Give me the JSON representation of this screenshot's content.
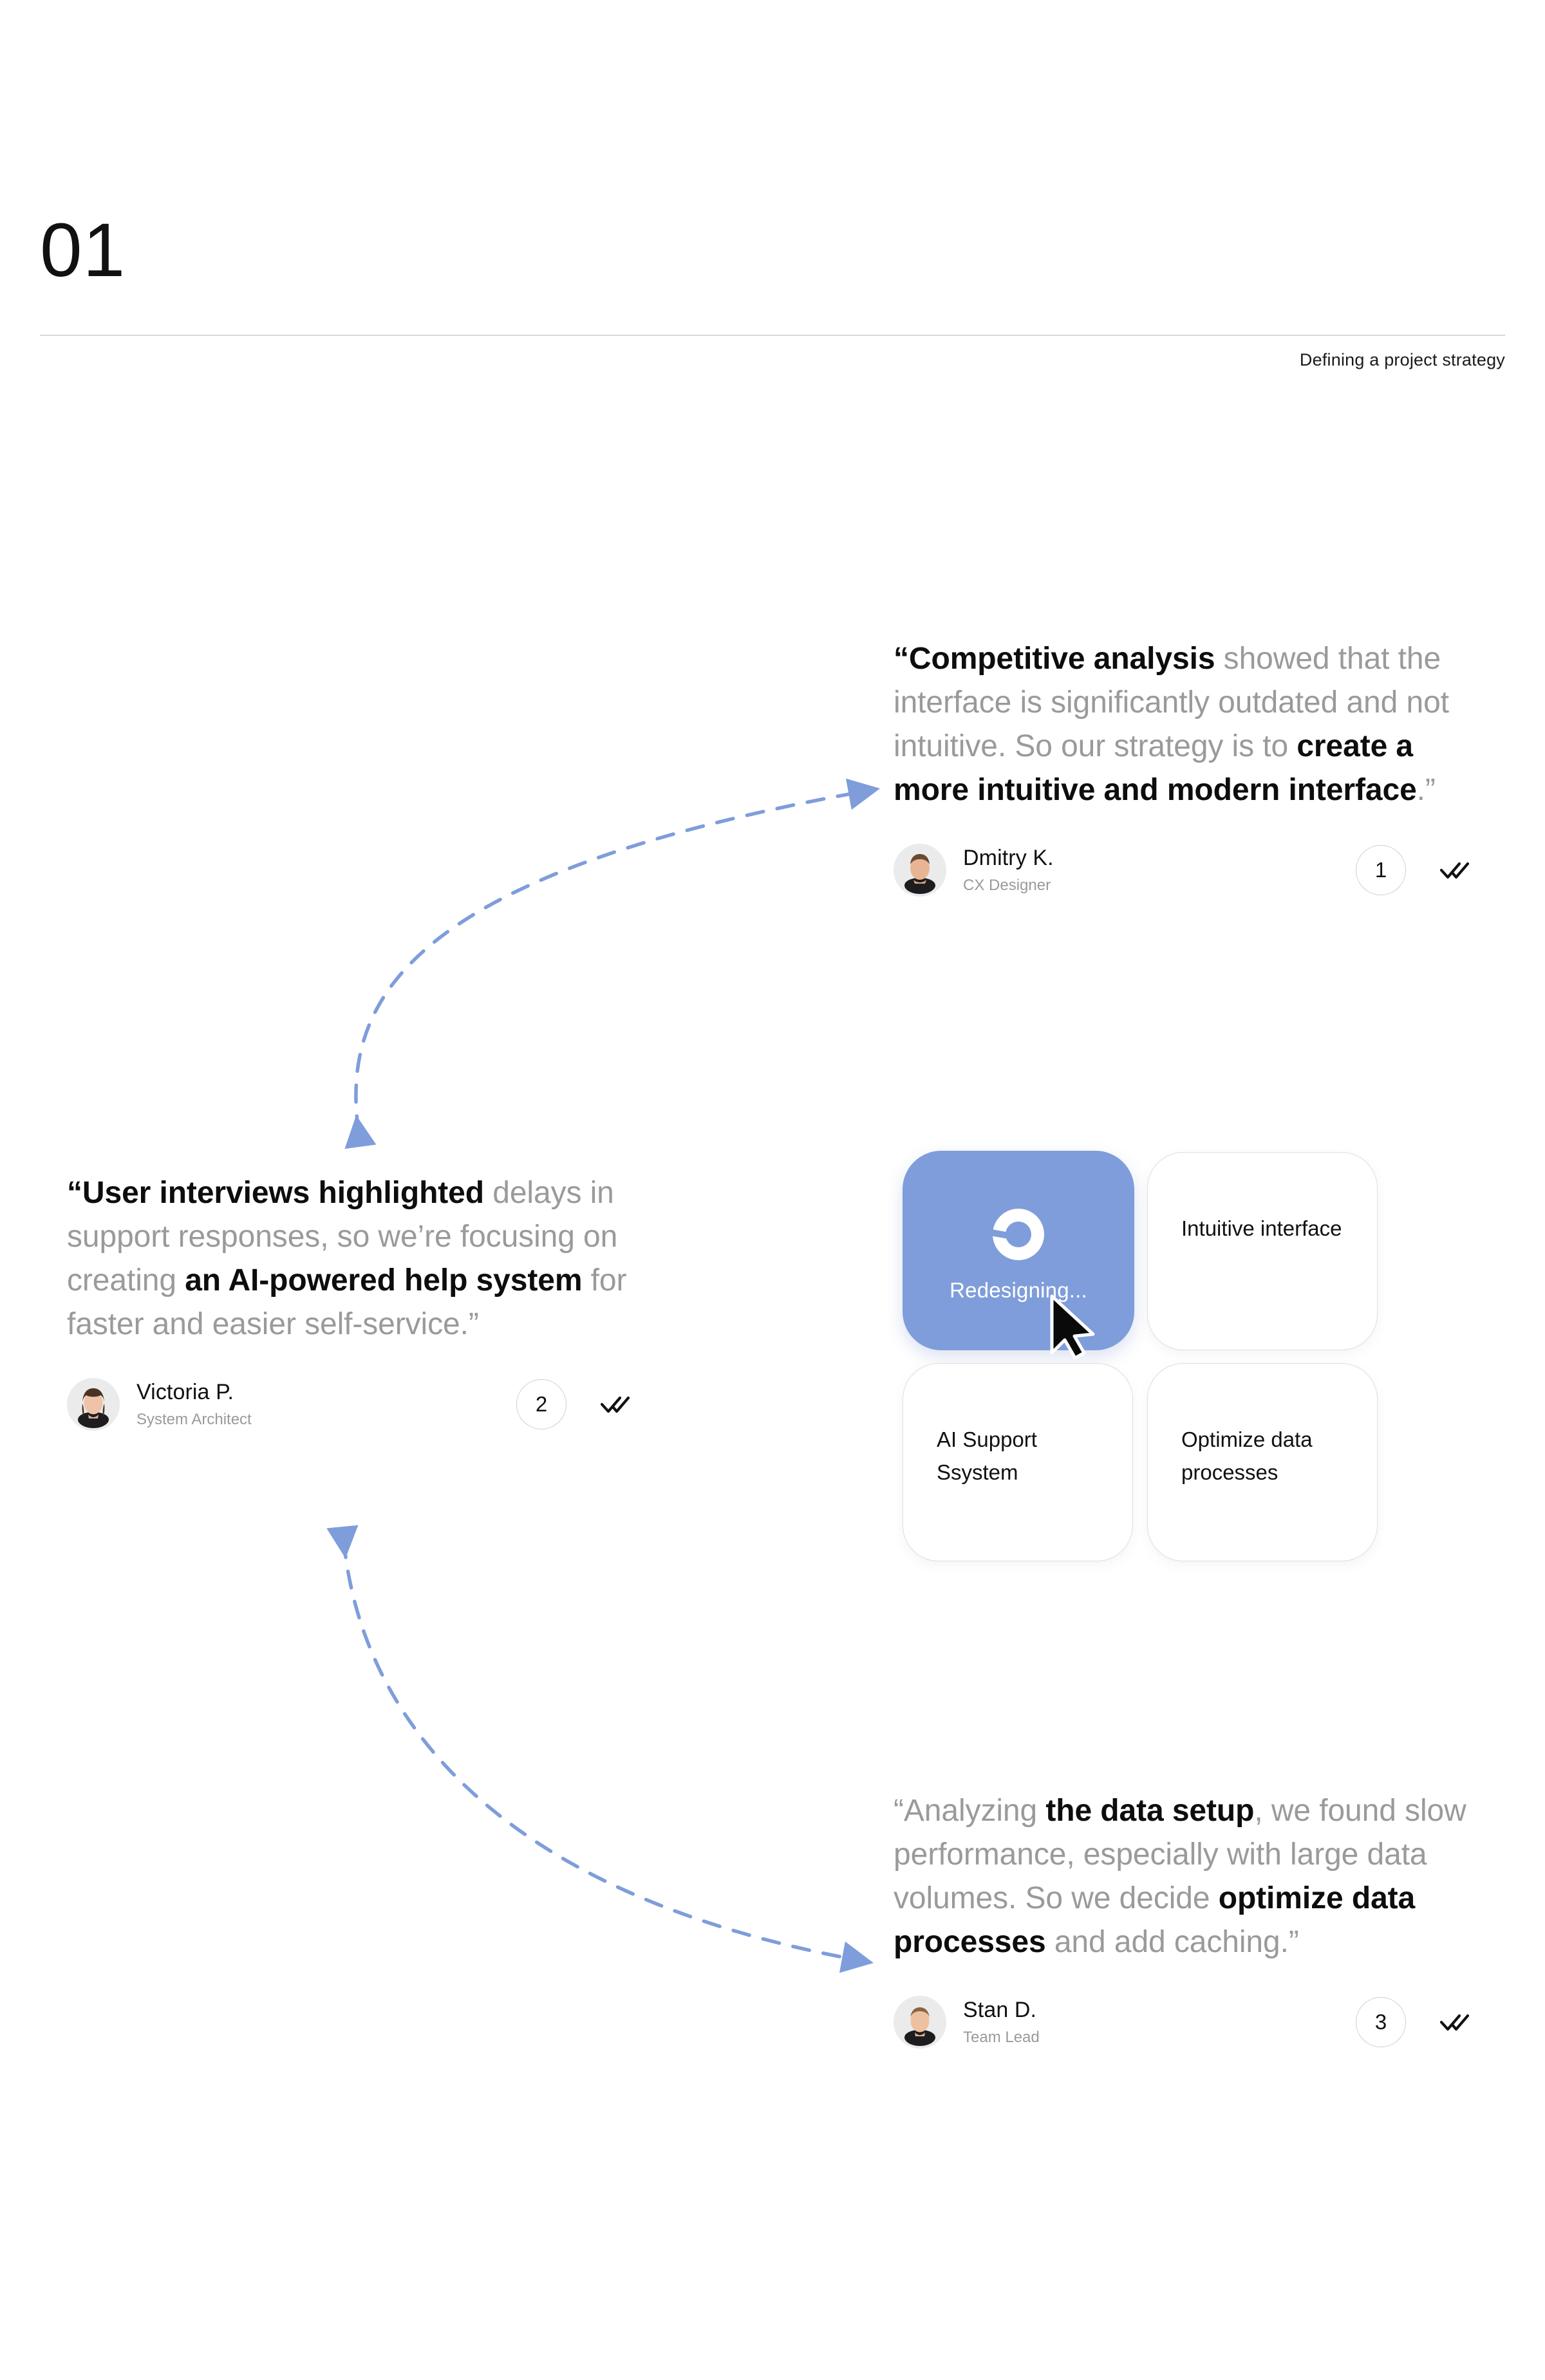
{
  "header": {
    "section_number": "01",
    "subtitle": "Defining a project strategy"
  },
  "quotes": [
    {
      "id": "quote-1",
      "open_quote": "“",
      "segments": [
        {
          "text": "Competitive analysis",
          "emphasis": true
        },
        {
          "text": " showed that the interface is significantly outdated and not intuitive. So our strategy is to ",
          "emphasis": false
        },
        {
          "text": "create a more intuitive and modern interface",
          "emphasis": true
        },
        {
          "text": ".",
          "emphasis": false
        }
      ],
      "close_quote": "”",
      "author": {
        "name": "Dmitry K.",
        "role": "CX Designer"
      },
      "badge": "1",
      "status_icon": "double-check-icon"
    },
    {
      "id": "quote-2",
      "open_quote": "“",
      "segments": [
        {
          "text": "User interviews highlighted",
          "emphasis": true
        },
        {
          "text": " delays in support responses, so we’re focusing on creating ",
          "emphasis": false
        },
        {
          "text": "an AI-powered help system",
          "emphasis": true
        },
        {
          "text": " for faster and easier self-service.",
          "emphasis": false
        }
      ],
      "close_quote": "”",
      "author": {
        "name": "Victoria P.",
        "role": "System Architect"
      },
      "badge": "2",
      "status_icon": "double-check-icon"
    },
    {
      "id": "quote-3",
      "open_quote": "“",
      "segments": [
        {
          "text": "Analyzing ",
          "emphasis": false
        },
        {
          "text": "the data setup",
          "emphasis": true
        },
        {
          "text": ", we found slow performance, especially with large data volumes. So we decide ",
          "emphasis": false
        },
        {
          "text": "optimize data processes",
          "emphasis": true
        },
        {
          "text": " and add caching.",
          "emphasis": false
        }
      ],
      "close_quote": "”",
      "author": {
        "name": "Stan D.",
        "role": "Team Lead"
      },
      "badge": "3",
      "status_icon": "double-check-icon"
    }
  ],
  "cards": {
    "active": {
      "label": "Redesigning...",
      "icon": "loading-spinner-icon",
      "cursor": "mouse-pointer-icon",
      "color": "#7e9dda"
    },
    "items": [
      {
        "label": "Intuitive interface"
      },
      {
        "label": "AI Support Ssystem"
      },
      {
        "label": "Optimize data processes"
      }
    ]
  },
  "connectors": [
    {
      "name": "arrow-quote2-to-quote1",
      "color": "#7e9dda",
      "style": "dashed",
      "heads": "both"
    },
    {
      "name": "arrow-quote2-to-quote3",
      "color": "#7e9dda",
      "style": "dashed",
      "heads": "both"
    }
  ],
  "colors": {
    "accent": "#7e9dda",
    "muted_text": "#9a9a9a",
    "primary_text": "#0d0d0d",
    "rule": "#d9d9d9",
    "card_border": "#dedede"
  }
}
